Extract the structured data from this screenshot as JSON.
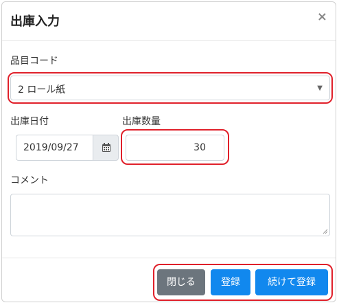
{
  "dialog": {
    "title": "出庫入力",
    "close_glyph": "×"
  },
  "fields": {
    "item_code": {
      "label": "品目コード",
      "selected": "2 ロール紙"
    },
    "date": {
      "label": "出庫日付",
      "value": "2019/09/27"
    },
    "quantity": {
      "label": "出庫数量",
      "value": "30"
    },
    "comment": {
      "label": "コメント",
      "value": ""
    }
  },
  "footer": {
    "close_label": "閉じる",
    "register_label": "登録",
    "continue_register_label": "続けて登録"
  },
  "colors": {
    "highlight": "#e0202a",
    "primary_button": "#1188ee",
    "secondary_button": "#6c757d"
  },
  "icons": {
    "close": "close-icon",
    "calendar": "calendar-icon",
    "caret": "chevron-down-icon"
  }
}
